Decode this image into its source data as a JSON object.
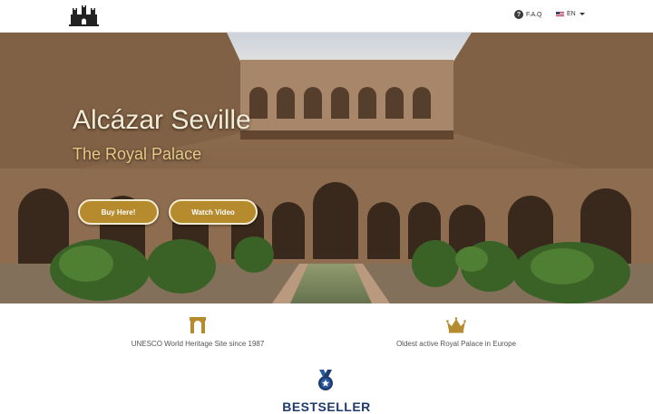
{
  "header": {
    "logo_icon": "castle-logo-icon",
    "faq_label": "F.A.Q",
    "lang_label": "EN",
    "flag_icon": "us-flag-icon"
  },
  "hero": {
    "title": "Alcázar Seville",
    "subtitle": "The Royal Palace",
    "buy_label": "Buy Here!",
    "video_label": "Watch Video",
    "accent_color": "#b68b2e"
  },
  "features": [
    {
      "icon": "arch-icon",
      "text": "UNESCO World Heritage Site since 1987"
    },
    {
      "icon": "crown-icon",
      "text": "Oldest active Royal Palace in Europe"
    }
  ],
  "bestseller": {
    "icon": "medal-icon",
    "label": "BESTSELLER"
  }
}
